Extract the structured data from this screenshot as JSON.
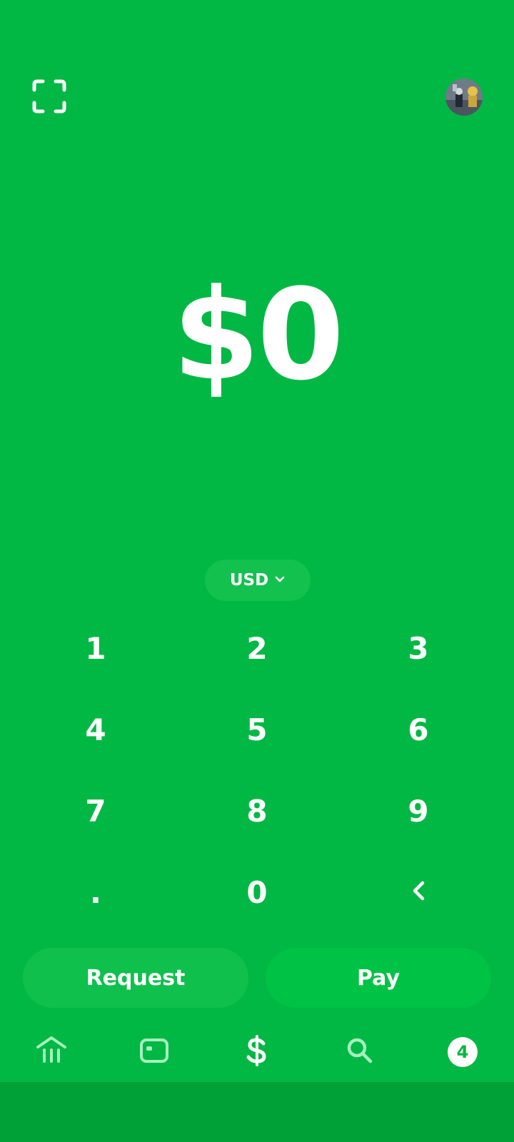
{
  "header": {
    "scan_icon": "scan-frame-icon",
    "avatar_icon": "profile-photo"
  },
  "amount": {
    "display": "$0"
  },
  "currency": {
    "label": "USD",
    "icon": "chevron-down-icon"
  },
  "keypad": {
    "keys": [
      "1",
      "2",
      "3",
      "4",
      "5",
      "6",
      "7",
      "8",
      "9",
      ".",
      "0"
    ],
    "backspace_icon": "chevron-left-icon"
  },
  "actions": {
    "request_label": "Request",
    "pay_label": "Pay"
  },
  "tabbar": {
    "items": [
      {
        "icon": "bank-icon"
      },
      {
        "icon": "card-icon"
      },
      {
        "icon": "dollar-icon"
      },
      {
        "icon": "search-icon"
      },
      {
        "icon": "activity-badge",
        "badge": "4"
      }
    ]
  },
  "colors": {
    "background": "#00b843",
    "bottom_bar": "#00a137",
    "button": "#0fc04d",
    "text": "#ffffff"
  }
}
